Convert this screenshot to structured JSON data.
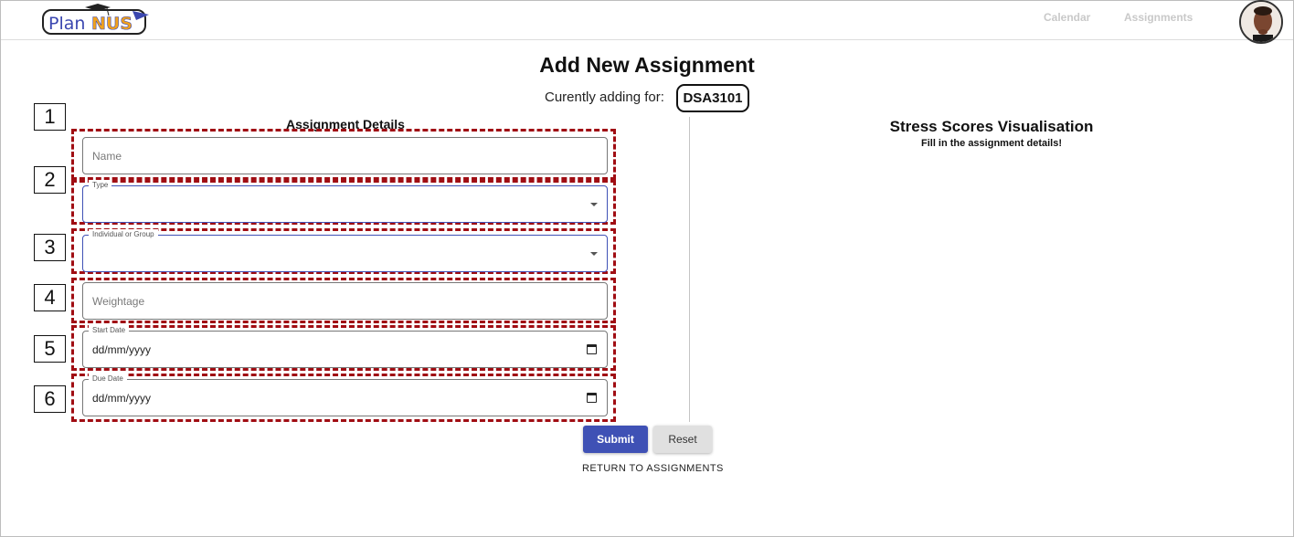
{
  "nav": {
    "logo_text_plain": "Plan",
    "logo_text_accent": "NUS",
    "calendar": "Calendar",
    "assignments": "Assignments"
  },
  "page": {
    "title": "Add New Assignment",
    "adding_for_label": "Curently adding for:",
    "module": "DSA3101"
  },
  "form": {
    "section_title": "Assignment Details",
    "name": {
      "placeholder": "Name",
      "value": ""
    },
    "type": {
      "label": "Type",
      "value": ""
    },
    "group": {
      "label": "Individual or Group",
      "value": ""
    },
    "weightage": {
      "placeholder": "Weightage",
      "value": ""
    },
    "start_date": {
      "label": "Start Date",
      "value": "dd/mm/yyyy"
    },
    "due_date": {
      "label": "Due Date",
      "value": "dd/mm/yyyy"
    },
    "submit": "Submit",
    "reset": "Reset",
    "return": "RETURN TO ASSIGNMENTS"
  },
  "annotations": [
    "1",
    "2",
    "3",
    "4",
    "5",
    "6"
  ],
  "visualisation": {
    "title": "Stress Scores Visualisation",
    "subtitle": "Fill in the assignment details!"
  },
  "colors": {
    "primary": "#3f51b5",
    "annotation_dash": "#a00d13",
    "nav_muted": "#c9c9c9"
  }
}
